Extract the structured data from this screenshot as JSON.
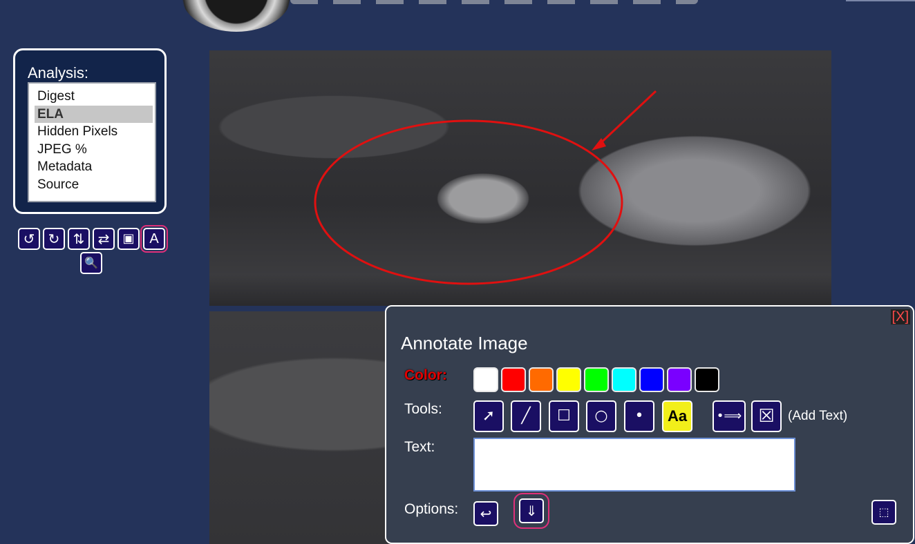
{
  "analysis": {
    "title": "Analysis:",
    "items": [
      {
        "label": "Digest",
        "selected": false
      },
      {
        "label": "ELA",
        "selected": true
      },
      {
        "label": "Hidden Pixels",
        "selected": false
      },
      {
        "label": "JPEG %",
        "selected": false
      },
      {
        "label": "Metadata",
        "selected": false
      },
      {
        "label": "Source",
        "selected": false
      }
    ]
  },
  "image_tools": {
    "rotate_left": "↺",
    "rotate_right": "↻",
    "flip_vertical": "⇅",
    "flip_horizontal": "⇄",
    "crop": "▣",
    "annotate": "A",
    "zoom": "🔍"
  },
  "annotate": {
    "title": "Annotate Image",
    "close": "[X]",
    "color_label": "Color:",
    "colors": [
      "#ffffff",
      "#ff0000",
      "#ff6a00",
      "#ffff00",
      "#00ff00",
      "#00ffff",
      "#0000ff",
      "#7a00ff",
      "#000000"
    ],
    "tools_label": "Tools:",
    "tools": {
      "arrow": "➚",
      "line": "╱",
      "rectangle": "☐",
      "circle": "○",
      "dot": "•",
      "text": "Aa",
      "move": "•⟹",
      "delete": "☒"
    },
    "add_text_hint": "(Add Text)",
    "text_label": "Text:",
    "text_value": "",
    "options_label": "Options:",
    "options": {
      "undo": "↩",
      "download": "⇓",
      "select": "⬚"
    }
  },
  "colors": {
    "page_bg": "#24335a",
    "panel_bg": "#12244a",
    "button_bg": "#1a0f63",
    "dialog_bg": "#363f4f",
    "highlight": "#e0307a",
    "annotation_red": "#e01010"
  }
}
